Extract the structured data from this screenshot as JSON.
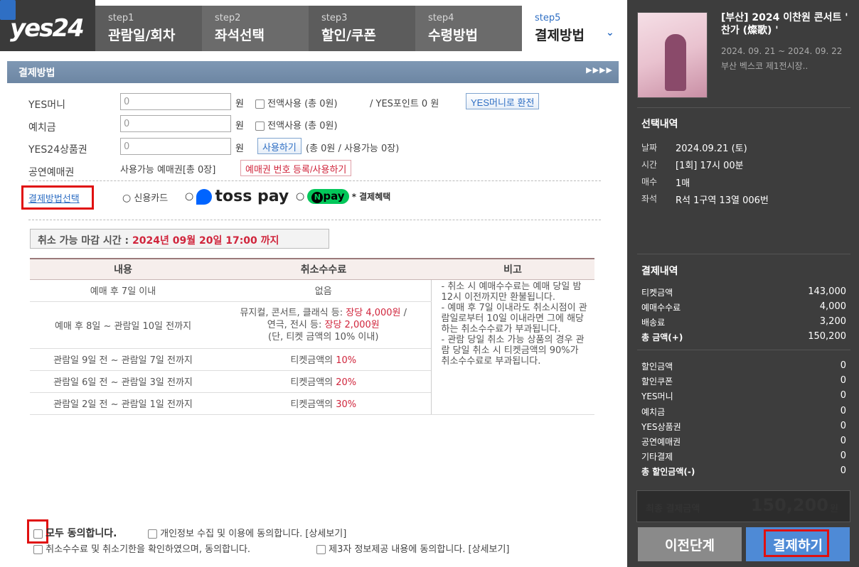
{
  "logo": "yes24",
  "steps": [
    {
      "num": "step1",
      "label": "관람일/회차"
    },
    {
      "num": "step2",
      "label": "좌석선택"
    },
    {
      "num": "step3",
      "label": "할인/쿠폰"
    },
    {
      "num": "step4",
      "label": "수령방법"
    },
    {
      "num": "step5",
      "label": "결제방법"
    }
  ],
  "section_title": "결제방법",
  "section_arrows": "▶▶▶▶",
  "form": {
    "yesmoney": {
      "label": "YES머니",
      "value": "0",
      "unit": "원",
      "all_use": "전액사용 (총 0원)",
      "point_text": "/ YES포인트 0 원",
      "convert_btn": "YES머니로 환전"
    },
    "deposit": {
      "label": "예치금",
      "value": "0",
      "unit": "원",
      "all_use": "전액사용 (총 0원)"
    },
    "giftcard": {
      "label": "YES24상품권",
      "value": "0",
      "unit": "원",
      "use_btn": "사용하기",
      "info": "(총 0원 / 사용가능 0장)"
    },
    "ticket_voucher": {
      "label": "공연예매권",
      "info": "사용가능 예매권[총 0장]",
      "register_btn": "예매권 번호 등록/사용하기"
    },
    "pay_method": {
      "label": "결제방법선택",
      "credit": "신용카드",
      "toss": "toss pay",
      "npay": "pay",
      "benefit": "결제혜택"
    }
  },
  "cancel_deadline": {
    "prefix": "취소 가능 마감 시간 :",
    "value": "2024년 09월 20일 17:00 까지"
  },
  "cancel_table": {
    "headers": [
      "내용",
      "취소수수료",
      "비고"
    ],
    "rows": [
      {
        "period": "예매 후 7일 이내",
        "fee": "없음"
      },
      {
        "period": "예매 후 8일 ~ 관람일 10일 전까지",
        "fee_a": "뮤지컬, 콘서트, 클래식 등:",
        "fee_a_red": "장당 4,000원",
        "fee_a_end": "/",
        "fee_b": "연극, 전시 등:",
        "fee_b_red": "장당 2,000원",
        "fee_c": "(단, 티켓 금액의 10% 이내)"
      },
      {
        "period": "관람일 9일 전 ~ 관람일 7일 전까지",
        "fee": "티켓금액의",
        "pct": "10%"
      },
      {
        "period": "관람일 6일 전 ~ 관람일 3일 전까지",
        "fee": "티켓금액의",
        "pct": "20%"
      },
      {
        "period": "관람일 2일 전 ~ 관람일 1일 전까지",
        "fee": "티켓금액의",
        "pct": "30%"
      }
    ],
    "note": "- 취소 시 예매수수료는 예매 당일 밤 12시 이전까지만 환불됩니다.\n- 예매 후 7일 이내라도 취소시점이 관람일로부터 10일 이내라면 그에 해당하는 취소수수료가 부과됩니다.\n- 관람 당일 취소 가능 상품의 경우 관람 당일 취소 시 티켓금액의 90%가 취소수수료로 부과됩니다."
  },
  "agree": {
    "all": "모두 동의합니다.",
    "privacy": "개인정보 수집 및 이용에 동의합니다. [상세보기]",
    "cancel": "취소수수료 및 취소기한을 확인하였으며, 동의합니다.",
    "third": "제3자 정보제공 내용에 동의합니다. [상세보기]"
  },
  "sidebar": {
    "title": "[부산] 2024 이찬원 콘서트 ' 찬가 (燦歌) '",
    "date": "2024. 09. 21 ~ 2024. 09. 22",
    "venue": "부산 벡스코 제1전시장..",
    "selection_title": "선택내역",
    "selection": [
      {
        "k": "날짜",
        "v": "2024.09.21 (토)"
      },
      {
        "k": "시간",
        "v": "[1회] 17시 00분"
      },
      {
        "k": "매수",
        "v": "1매"
      },
      {
        "k": "좌석",
        "v": "R석 1구역 13열 006번"
      }
    ],
    "payment_title": "결제내역",
    "payment": [
      {
        "k": "티켓금액",
        "v": "143,000"
      },
      {
        "k": "예매수수료",
        "v": "4,000"
      },
      {
        "k": "배송료",
        "v": "3,200"
      },
      {
        "k": "총 금액(+)",
        "v": "150,200"
      }
    ],
    "discount": [
      {
        "k": "할인금액",
        "v": "0"
      },
      {
        "k": "할인쿠폰",
        "v": "0"
      },
      {
        "k": "YES머니",
        "v": "0"
      },
      {
        "k": "예치금",
        "v": "0"
      },
      {
        "k": "YES상품권",
        "v": "0"
      },
      {
        "k": "공연예매권",
        "v": "0"
      },
      {
        "k": "기타결제",
        "v": "0"
      },
      {
        "k": "총 할인금액(-)",
        "v": "0"
      }
    ],
    "final_label": "최종 결제금액",
    "final_amount": "150,200",
    "final_unit": "원",
    "prev_btn": "이전단계",
    "pay_btn": "결제하기"
  },
  "colors": {
    "accent": "#2f6fc4",
    "red": "#d0253c",
    "highlight": "#e01010",
    "sidebar": "#3d3d3d"
  }
}
